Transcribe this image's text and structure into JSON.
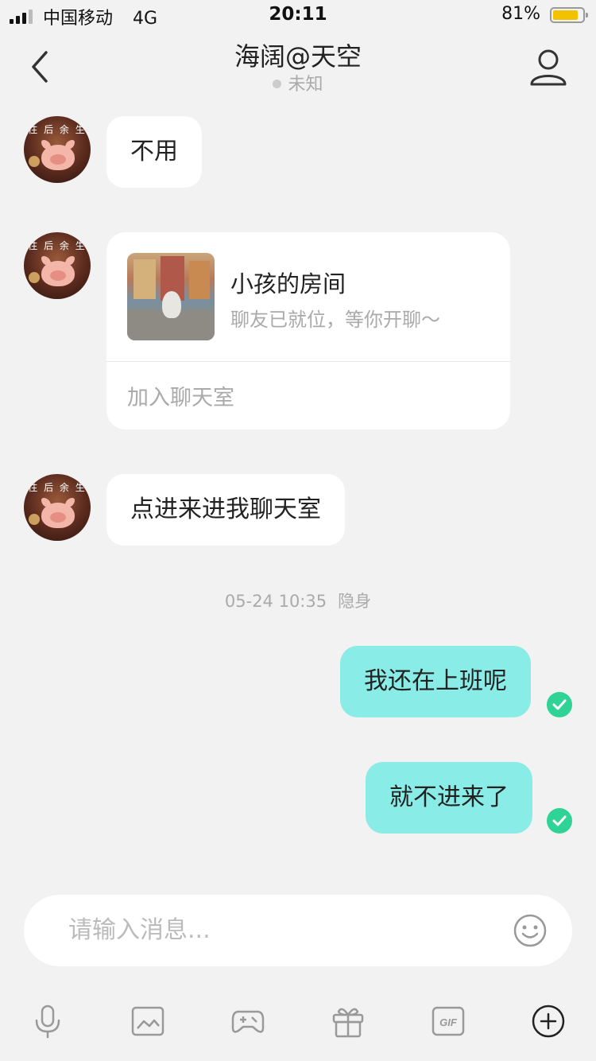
{
  "status_bar": {
    "carrier": "中国移动",
    "network": "4G",
    "time": "20:11",
    "battery_percent": "81%",
    "battery_level": 0.81,
    "signal_bars": 3
  },
  "header": {
    "title": "海阔@天空",
    "status": "未知"
  },
  "avatar": {
    "caption": "往 后 余 生"
  },
  "messages": {
    "m1": {
      "text": "不用"
    },
    "card": {
      "title": "小孩的房间",
      "description": "聊友已就位，等你开聊～",
      "action": "加入聊天室"
    },
    "m3": {
      "text": "点进来进我聊天室"
    },
    "timestamp": {
      "date_time": "05-24 10:35",
      "state": "隐身"
    },
    "m4": {
      "text": "我还在上班呢"
    },
    "m5": {
      "text": "就不进来了"
    }
  },
  "input": {
    "placeholder": "请输入消息..."
  },
  "toolbar": {
    "icons": [
      "microphone-icon",
      "image-icon",
      "gamepad-icon",
      "gift-icon",
      "gif-icon",
      "plus-icon"
    ],
    "gif_label": "GIF"
  },
  "colors": {
    "background": "#f2f2f2",
    "outgoing_bubble": "#8aece6",
    "read_check": "#2fd395",
    "battery": "#f2c200"
  }
}
